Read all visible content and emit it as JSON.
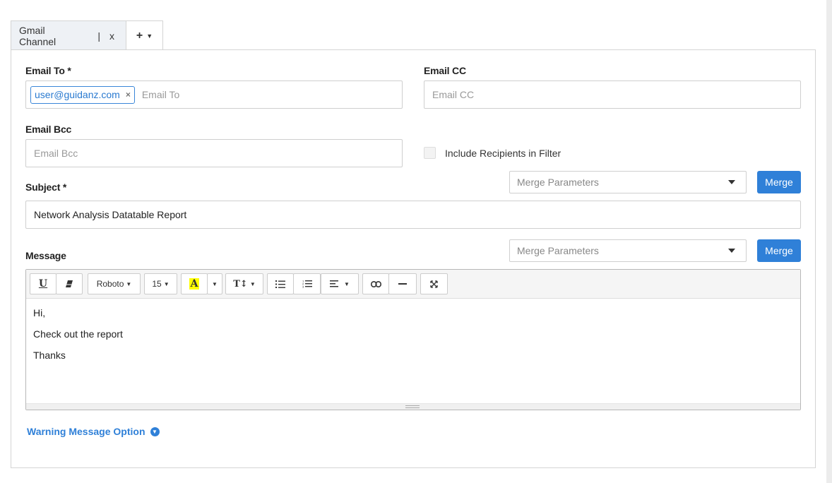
{
  "tabs": {
    "active_label": "Gmail Channel",
    "separator": "|",
    "close": "x",
    "add_label": "+"
  },
  "form": {
    "email_to": {
      "label": "Email To *",
      "chip": "user@guidanz.com",
      "chip_remove": "×",
      "placeholder": "Email To"
    },
    "email_cc": {
      "label": "Email CC",
      "placeholder": "Email CC"
    },
    "email_bcc": {
      "label": "Email Bcc",
      "placeholder": "Email Bcc"
    },
    "include_recipients": {
      "label": "Include Recipients in Filter",
      "checked": false
    },
    "subject": {
      "label": "Subject *",
      "value": "Network Analysis Datatable Report",
      "merge_placeholder": "Merge Parameters",
      "merge_button": "Merge"
    },
    "message": {
      "label": "Message",
      "merge_placeholder": "Merge Parameters",
      "merge_button": "Merge",
      "toolbar": {
        "underline": "U",
        "eraser": "eraser-icon",
        "font_family": "Roboto",
        "font_size": "15",
        "highlight": "A",
        "text_height": "T↕",
        "ul": "unordered-list-icon",
        "ol": "ordered-list-icon",
        "align": "align-icon",
        "link": "link-icon",
        "hr": "horizontal-rule-icon",
        "fullscreen": "fullscreen-icon"
      },
      "lines": [
        "Hi,",
        "Check out the report",
        "Thanks"
      ]
    },
    "warning_option": {
      "label": "Warning Message Option"
    }
  },
  "colors": {
    "accent": "#2f80d8",
    "border": "#cfcfcf"
  }
}
